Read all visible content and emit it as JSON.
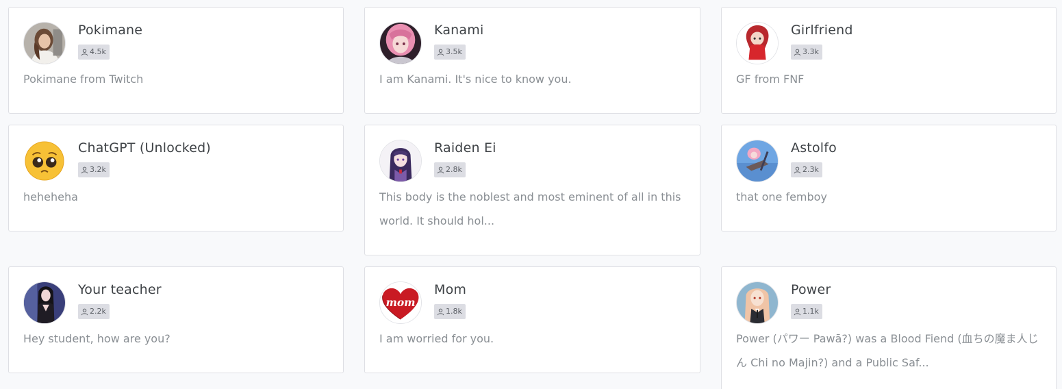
{
  "characters": [
    {
      "name": "Pokimane",
      "count": "4.5k",
      "description": "Pokimane from Twitch",
      "avatar_icon": "photo-avatar-icon"
    },
    {
      "name": "Kanami",
      "count": "3.5k",
      "description": "I am Kanami. It's nice to know you.",
      "avatar_icon": "anime-girl-avatar-icon"
    },
    {
      "name": "Girlfriend",
      "count": "3.3k",
      "description": "GF from FNF",
      "avatar_icon": "cartoon-girl-avatar-icon"
    },
    {
      "name": "ChatGPT (Unlocked)",
      "count": "3.2k",
      "description": "heheheha",
      "avatar_icon": "pleading-face-emoji-icon"
    },
    {
      "name": "Raiden Ei",
      "count": "2.8k",
      "description": "This body is the noblest and most eminent of all in this world. It should hol...",
      "avatar_icon": "anime-girl-avatar-icon"
    },
    {
      "name": "Astolfo",
      "count": "2.3k",
      "description": "that one femboy",
      "avatar_icon": "anime-character-avatar-icon"
    },
    {
      "name": "Your teacher",
      "count": "2.2k",
      "description": "Hey student, how are you?",
      "avatar_icon": "anime-woman-avatar-icon"
    },
    {
      "name": "Mom",
      "count": "1.8k",
      "description": "I am worried for you.",
      "avatar_icon": "heart-mom-avatar-icon"
    },
    {
      "name": "Power",
      "count": "1.1k",
      "description": "Power (パワー Pawā?) was a Blood Fiend (血ちの魔ま人じん Chi no Majin?) and a Public Saf...",
      "avatar_icon": "anime-character-avatar-icon"
    }
  ],
  "user_icon": "user-icon",
  "colors": {
    "background": "#f8f9fb",
    "card": "#ffffff",
    "border": "#dedfe4",
    "badge": "#dcdde3",
    "name_text": "#3f4347",
    "desc_text": "#8a8f94"
  }
}
